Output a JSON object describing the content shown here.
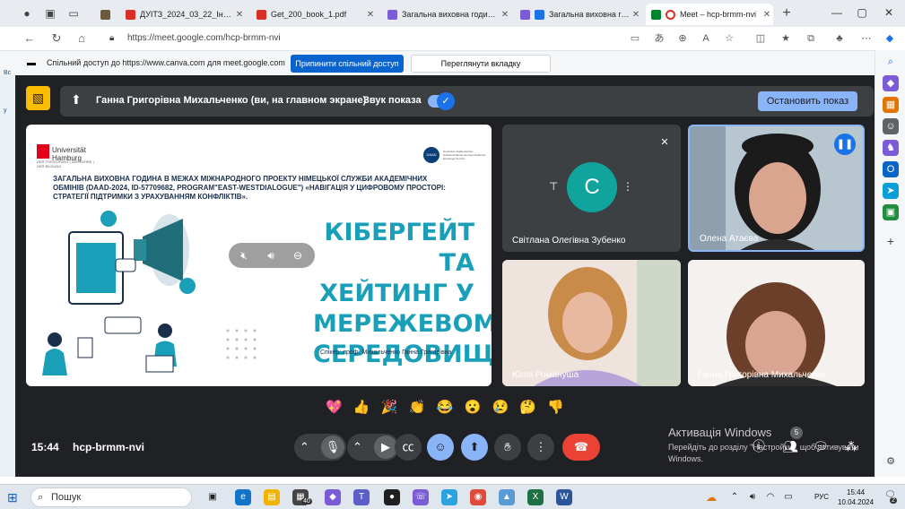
{
  "browser": {
    "tabs": [
      {
        "title": "",
        "favicon_color": "#6b5b3e"
      },
      {
        "title": "ДУІТЗ_2024_03_22_Інформ_д",
        "favicon_color": "#d93025"
      },
      {
        "title": "Get_200_book_1.pdf",
        "favicon_color": "#d93025"
      },
      {
        "title": "Загальна виховна година на",
        "favicon_color": "#7b5cd6"
      },
      {
        "title": "Загальна виховна годи",
        "favicon_color": "#7b5cd6"
      },
      {
        "title": "Meet – hcp-brmm-nvi",
        "favicon_color": "#00832d"
      }
    ],
    "url": "https://meet.google.com/hcp-brmm-nvi",
    "share_bar": {
      "text": "Спільний доступ до https://www.canva.com для meet.google.com",
      "stop_label": "Припинити спільний доступ",
      "switch_label": "Переглянути вкладку www.canva.com"
    }
  },
  "left_edge": {
    "label_top": "Вс",
    "label_mid": "у"
  },
  "meet": {
    "presenting_name": "Ганна Григорівна Михальченко (ви, на главном экране)",
    "sound_label": "Звук показа",
    "sound_on": true,
    "stop_button": "Остановить показ",
    "slide": {
      "logo_text": "Universität Hamburg",
      "logo_sub": "DER FORSCHUNG | DER LEHRE | DER BILDUNG",
      "daad_logo": "DAAD",
      "daad_text": "Deutscher Akademischer Austauschdienst German Academic Exchange Service",
      "headline": "Загальна виховна година в межах міжнародного проекту Німецької служби академічних обмінів (DAAD-2024, ID-57709682, Program\"East-WestDialogue\") «Навігація у цифровому просторі: стратегії підтримки з урахуванням конфліктів».",
      "title_lines": [
        "КІБЕРГЕЙТ ТА",
        "ХЕЙТИНГ У",
        "МЕРЕЖЕВОМУ",
        "СЕРЕДОВИЩІ"
      ],
      "speaker": "Спікер: проф. Михальченко Ганна Григорівна"
    },
    "participants": [
      {
        "name": "Світлана Олегівна Зубенко",
        "avatar_letter": "С",
        "muted": true
      },
      {
        "name": "Олена Атаєва",
        "speaking": true
      },
      {
        "name": "Юлія Романуша"
      },
      {
        "name": "Ганна Григорівна Михальченко"
      }
    ],
    "reactions": [
      "💖",
      "👍",
      "🎉",
      "👏",
      "😂",
      "😮",
      "😢",
      "🤔",
      "👎"
    ],
    "time": "15:44",
    "meeting_code": "hcp-brmm-nvi",
    "participant_count": "5",
    "activation": {
      "title": "Активація Windows",
      "text": "Перейдіть до розділу \"Настройки\", щоб активувати Windows."
    }
  },
  "taskbar": {
    "search_placeholder": "Пошук",
    "badge_count": "40",
    "lang": "РУС",
    "time": "15:44",
    "date": "10.04.2024",
    "notification_count": "2"
  }
}
